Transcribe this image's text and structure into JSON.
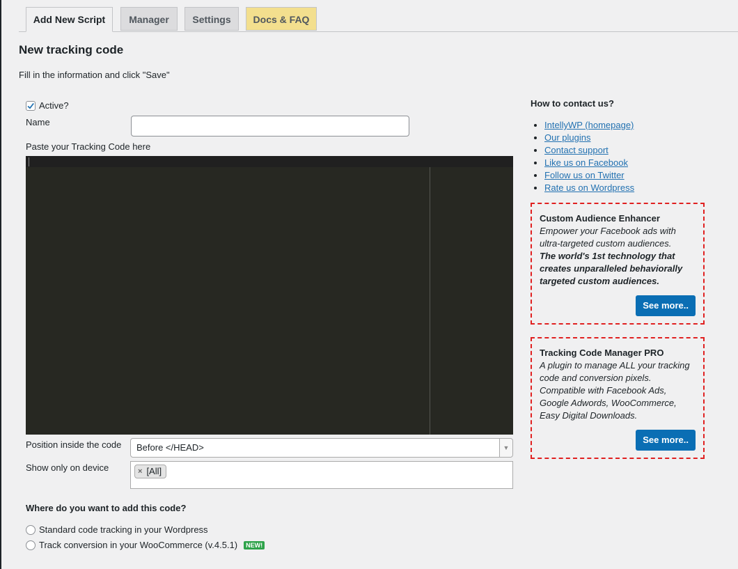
{
  "tabs": [
    {
      "label": "Add New Script"
    },
    {
      "label": "Manager"
    },
    {
      "label": "Settings"
    },
    {
      "label": "Docs & FAQ"
    }
  ],
  "page": {
    "title": "New tracking code",
    "intro": "Fill in the information and click \"Save\""
  },
  "form": {
    "active_label": "Active?",
    "active_checked": true,
    "name_label": "Name",
    "name_value": "",
    "code_label": "Paste your Tracking Code here",
    "position_label": "Position inside the code",
    "position_value": "Before </HEAD>",
    "device_label": "Show only on device",
    "device_tags": [
      "[All]"
    ],
    "where_title": "Where do you want to add this code?",
    "radio_standard": "Standard code tracking in your Wordpress",
    "radio_woo": "Track conversion in your WooCommerce (v.4.5.1)",
    "new_badge": "NEW!"
  },
  "sidebar": {
    "contact_title": "How to contact us?",
    "links": [
      "IntellyWP (homepage)",
      "Our plugins",
      "Contact support",
      "Like us on Facebook",
      "Follow us on Twitter",
      "Rate us on Wordpress"
    ],
    "promo1": {
      "title": "Custom Audience Enhancer",
      "desc": "Empower your Facebook ads with ultra-targeted custom audiences.",
      "bold": "The world's 1st technology that creates unparalleled behaviorally targeted custom audiences.",
      "button": "See more.."
    },
    "promo2": {
      "title": "Tracking Code Manager PRO",
      "desc": "A plugin to manage ALL your tracking code and conversion pixels. Compatible with Facebook Ads, Google Adwords, WooCommerce, Easy Digital Downloads.",
      "button": "See more.."
    }
  },
  "colors": {
    "accent": "#0a6eb4",
    "promo_border": "#e02020",
    "editor_bg": "#272822",
    "docs_tab": "#f3df8e",
    "new_badge": "#2ea34a"
  }
}
